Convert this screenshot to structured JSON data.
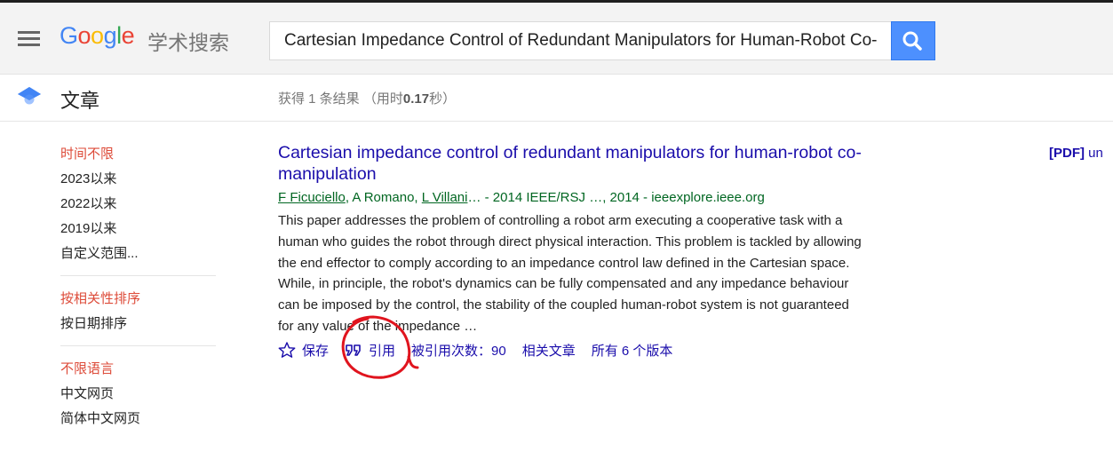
{
  "header": {
    "logo_letters": [
      {
        "ch": "G",
        "color": "#4285f4"
      },
      {
        "ch": "o",
        "color": "#ea4335"
      },
      {
        "ch": "o",
        "color": "#fbbc05"
      },
      {
        "ch": "g",
        "color": "#4285f4"
      },
      {
        "ch": "l",
        "color": "#34a853"
      },
      {
        "ch": "e",
        "color": "#ea4335"
      }
    ],
    "logo_suffix": "学术搜索",
    "search_value": "Cartesian Impedance Control of Redundant Manipulators for Human-Robot Co-manipulation",
    "search_icon": "search-icon",
    "menu_icon": "hamburger-menu-icon"
  },
  "subbar": {
    "section_title": "文章",
    "stats_prefix": "获得 1 条结果 （用时",
    "stats_time": "0.17",
    "stats_suffix": "秒）"
  },
  "sidebar": {
    "time_filters": [
      {
        "label": "时间不限",
        "active": true
      },
      {
        "label": "2023以来",
        "active": false
      },
      {
        "label": "2022以来",
        "active": false
      },
      {
        "label": "2019以来",
        "active": false
      },
      {
        "label": "自定义范围...",
        "active": false
      }
    ],
    "sort_options": [
      {
        "label": "按相关性排序",
        "active": true
      },
      {
        "label": "按日期排序",
        "active": false
      }
    ],
    "language_options": [
      {
        "label": "不限语言",
        "active": true
      },
      {
        "label": "中文网页",
        "active": false
      },
      {
        "label": "简体中文网页",
        "active": false
      }
    ]
  },
  "result": {
    "title": "Cartesian impedance control of redundant manipulators for human-robot co-manipulation",
    "authors": [
      "F Ficuciello",
      "A Romano",
      "L Villani"
    ],
    "author_separator": ", ",
    "source": "… - 2014 IEEE/RSJ …, 2014 - ieeexplore.ieee.org",
    "snippet": "This paper addresses the problem of controlling a robot arm executing a cooperative task with a human who guides the robot through direct physical interaction. This problem is tackled by allowing the end effector to comply according to an impedance control law defined in the Cartesian space. While, in principle, the robot's dynamics can be fully compensated and any impedance behaviour can be imposed by the control, the stability of the coupled human-robot system is not guaranteed for any value of the impedance …",
    "actions": {
      "save": "保存",
      "cite": "引用",
      "cited_by": "被引用次数：90",
      "related": "相关文章",
      "versions": "所有 6 个版本"
    },
    "pdf_tag": "[PDF]",
    "pdf_source": "un"
  },
  "colors": {
    "link": "#1a0dab",
    "green": "#006621",
    "active_filter": "#dd4b39",
    "search_button": "#4d90fe",
    "annotation": "#e0141e"
  }
}
